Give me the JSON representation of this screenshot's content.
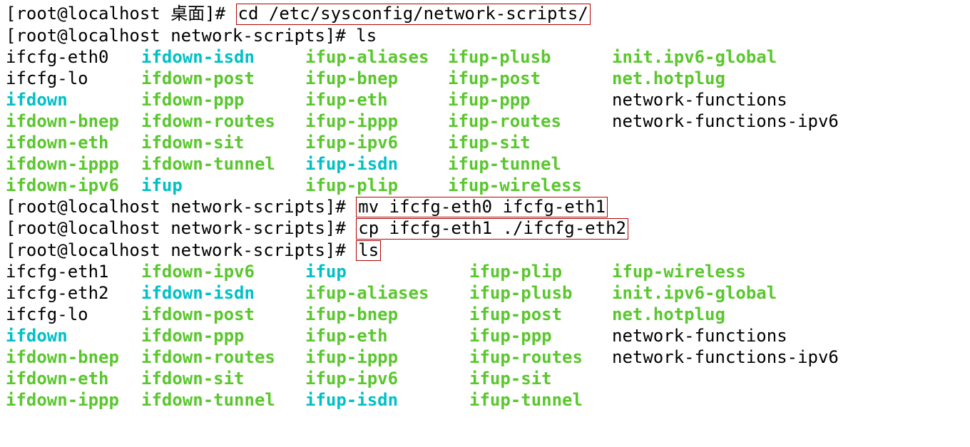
{
  "prompt1": {
    "prefix": "[root@localhost 桌面]# ",
    "cmd": "cd /etc/sysconfig/network-scripts/"
  },
  "prompt2": {
    "prefix": "[root@localhost network-scripts]# ",
    "cmd": "ls"
  },
  "ls1": [
    [
      {
        "t": "ifcfg-eth0",
        "c": "black"
      },
      {
        "t": "ifdown-isdn",
        "c": "cyan"
      },
      {
        "t": "ifup-aliases",
        "c": "green"
      },
      {
        "t": "ifup-plusb",
        "c": "green"
      },
      {
        "t": "init.ipv6-global",
        "c": "green"
      }
    ],
    [
      {
        "t": "ifcfg-lo",
        "c": "black"
      },
      {
        "t": "ifdown-post",
        "c": "green"
      },
      {
        "t": "ifup-bnep",
        "c": "green"
      },
      {
        "t": "ifup-post",
        "c": "green"
      },
      {
        "t": "net.hotplug",
        "c": "green"
      }
    ],
    [
      {
        "t": "ifdown",
        "c": "cyan"
      },
      {
        "t": "ifdown-ppp",
        "c": "green"
      },
      {
        "t": "ifup-eth",
        "c": "green"
      },
      {
        "t": "ifup-ppp",
        "c": "green"
      },
      {
        "t": "network-functions",
        "c": "black"
      }
    ],
    [
      {
        "t": "ifdown-bnep",
        "c": "green"
      },
      {
        "t": "ifdown-routes",
        "c": "green"
      },
      {
        "t": "ifup-ippp",
        "c": "green"
      },
      {
        "t": "ifup-routes",
        "c": "green"
      },
      {
        "t": "network-functions-ipv6",
        "c": "black"
      }
    ],
    [
      {
        "t": "ifdown-eth",
        "c": "green"
      },
      {
        "t": "ifdown-sit",
        "c": "green"
      },
      {
        "t": "ifup-ipv6",
        "c": "green"
      },
      {
        "t": "ifup-sit",
        "c": "green"
      },
      {
        "t": "",
        "c": "black"
      }
    ],
    [
      {
        "t": "ifdown-ippp",
        "c": "green"
      },
      {
        "t": "ifdown-tunnel",
        "c": "green"
      },
      {
        "t": "ifup-isdn",
        "c": "cyan"
      },
      {
        "t": "ifup-tunnel",
        "c": "green"
      },
      {
        "t": "",
        "c": "black"
      }
    ],
    [
      {
        "t": "ifdown-ipv6",
        "c": "green"
      },
      {
        "t": "ifup",
        "c": "cyan"
      },
      {
        "t": "ifup-plip",
        "c": "green"
      },
      {
        "t": "ifup-wireless",
        "c": "green"
      },
      {
        "t": "",
        "c": "black"
      }
    ]
  ],
  "prompt3": {
    "prefix": "[root@localhost network-scripts]# ",
    "cmd": "mv ifcfg-eth0 ifcfg-eth1"
  },
  "prompt4": {
    "prefix": "[root@localhost network-scripts]# ",
    "cmd": "cp ifcfg-eth1 ./ifcfg-eth2"
  },
  "prompt5": {
    "prefix": "[root@localhost network-scripts]# ",
    "cmd": "ls"
  },
  "ls2": [
    [
      {
        "t": "ifcfg-eth1",
        "c": "black"
      },
      {
        "t": "ifdown-ipv6",
        "c": "green"
      },
      {
        "t": "ifup",
        "c": "cyan"
      },
      {
        "t": "ifup-plip",
        "c": "green"
      },
      {
        "t": "ifup-wireless",
        "c": "green"
      }
    ],
    [
      {
        "t": "ifcfg-eth2",
        "c": "black"
      },
      {
        "t": "ifdown-isdn",
        "c": "cyan"
      },
      {
        "t": "ifup-aliases",
        "c": "green"
      },
      {
        "t": "ifup-plusb",
        "c": "green"
      },
      {
        "t": "init.ipv6-global",
        "c": "green"
      }
    ],
    [
      {
        "t": "ifcfg-lo",
        "c": "black"
      },
      {
        "t": "ifdown-post",
        "c": "green"
      },
      {
        "t": "ifup-bnep",
        "c": "green"
      },
      {
        "t": "ifup-post",
        "c": "green"
      },
      {
        "t": "net.hotplug",
        "c": "green"
      }
    ],
    [
      {
        "t": "ifdown",
        "c": "cyan"
      },
      {
        "t": "ifdown-ppp",
        "c": "green"
      },
      {
        "t": "ifup-eth",
        "c": "green"
      },
      {
        "t": "ifup-ppp",
        "c": "green"
      },
      {
        "t": "network-functions",
        "c": "black"
      }
    ],
    [
      {
        "t": "ifdown-bnep",
        "c": "green"
      },
      {
        "t": "ifdown-routes",
        "c": "green"
      },
      {
        "t": "ifup-ippp",
        "c": "green"
      },
      {
        "t": "ifup-routes",
        "c": "green"
      },
      {
        "t": "network-functions-ipv6",
        "c": "black"
      }
    ],
    [
      {
        "t": "ifdown-eth",
        "c": "green"
      },
      {
        "t": "ifdown-sit",
        "c": "green"
      },
      {
        "t": "ifup-ipv6",
        "c": "green"
      },
      {
        "t": "ifup-sit",
        "c": "green"
      },
      {
        "t": "",
        "c": "black"
      }
    ],
    [
      {
        "t": "ifdown-ippp",
        "c": "green"
      },
      {
        "t": "ifdown-tunnel",
        "c": "green"
      },
      {
        "t": "ifup-isdn",
        "c": "cyan"
      },
      {
        "t": "ifup-tunnel",
        "c": "green"
      },
      {
        "t": "",
        "c": "black"
      }
    ]
  ]
}
